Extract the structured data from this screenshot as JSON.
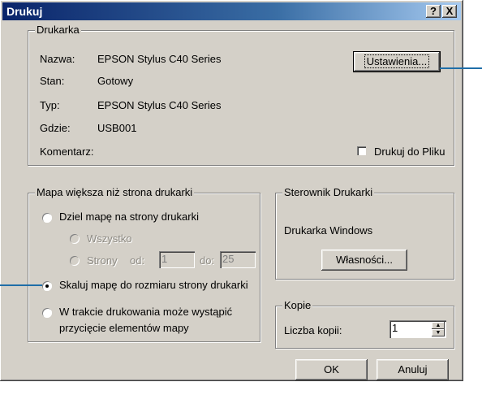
{
  "window": {
    "title": "Drukuj",
    "help_btn": "?",
    "close_btn": "X"
  },
  "printer_group": {
    "legend": "Drukarka",
    "name_label": "Nazwa:",
    "name_value": "EPSON Stylus C40 Series",
    "status_label": "Stan:",
    "status_value": "Gotowy",
    "type_label": "Typ:",
    "type_value": "EPSON Stylus C40 Series",
    "where_label": "Gdzie:",
    "where_value": "USB001",
    "comment_label": "Komentarz:",
    "settings_button": "Ustawienia...",
    "print_to_file": "Drukuj do Pliku",
    "print_to_file_checked": false
  },
  "map_group": {
    "legend": "Mapa większa niż strona drukarki",
    "divide_label": "Dziel mapę na strony drukarki",
    "all_label": "Wszystko",
    "pages_label": "Strony",
    "from_label": "od:",
    "from_value": "1",
    "to_label": "do:",
    "to_value": "25",
    "scale_label": "Skaluj mapę do rozmiaru strony drukarki",
    "clip_line1": "W trakcie drukowania może wystąpić",
    "clip_line2": "przycięcie elementów mapy",
    "selected": "scale"
  },
  "driver_group": {
    "legend": "Sterownik Drukarki",
    "driver_name": "Drukarka Windows",
    "properties_button": "Własności..."
  },
  "copies_group": {
    "legend": "Kopie",
    "copies_label": "Liczba kopii:",
    "copies_value": "1"
  },
  "buttons": {
    "ok": "OK",
    "cancel": "Anuluj"
  },
  "colors": {
    "titlebar": "#0a246a",
    "face": "#d4d0c8",
    "callout": "#1f6ea8"
  }
}
